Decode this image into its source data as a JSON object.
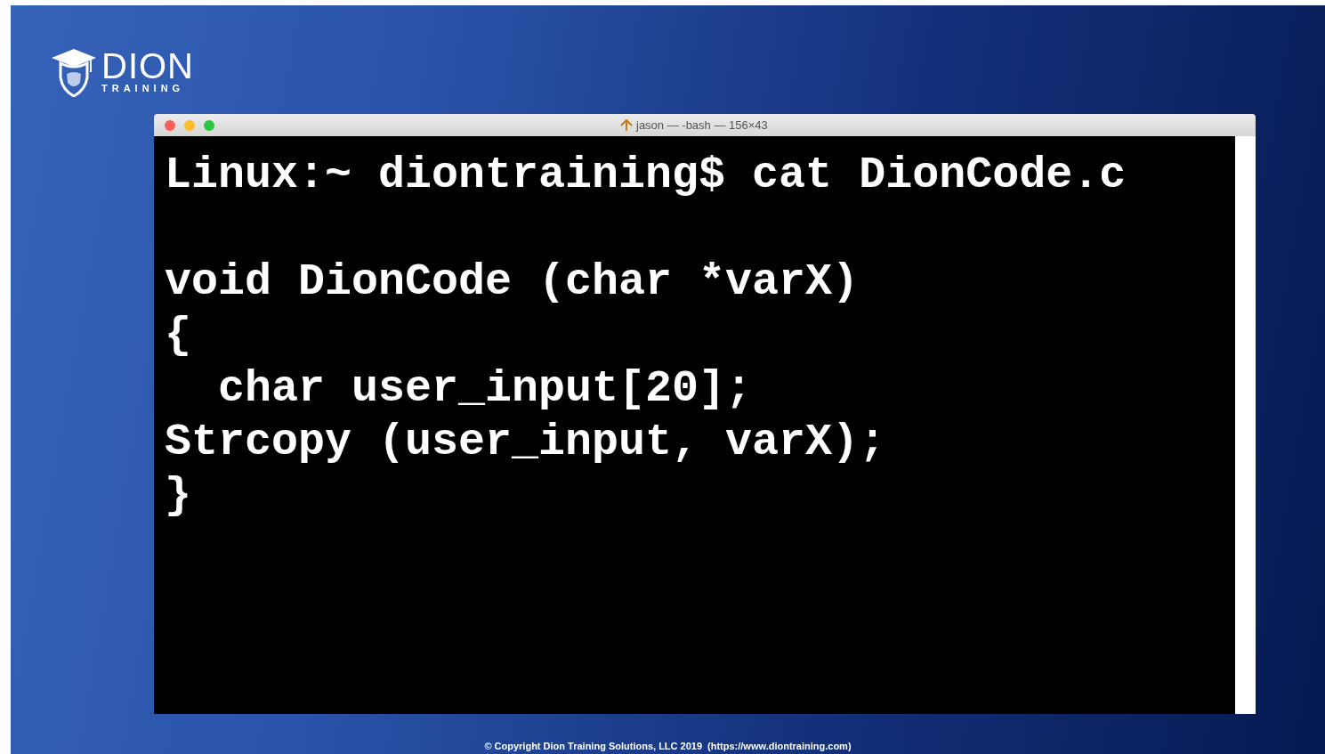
{
  "logo": {
    "name": "DION",
    "tagline": "TRAINING"
  },
  "terminal": {
    "title": "jason — -bash — 156×43",
    "lines": [
      {
        "text": "Linux:~ diontraining$ cat DionCode.c",
        "gap_before": false
      },
      {
        "text": "void DionCode (char *varX)",
        "gap_before": true
      },
      {
        "text": "{",
        "gap_before": false
      },
      {
        "text": "  char user_input[20];",
        "gap_before": false
      },
      {
        "text": "Strcopy (user_input, varX);",
        "gap_before": false
      },
      {
        "text": "}",
        "gap_before": false
      }
    ]
  },
  "footer": {
    "copyright": "© Copyright Dion Training Solutions, LLC 2019",
    "link": "(https://www.diontraining.com)"
  }
}
